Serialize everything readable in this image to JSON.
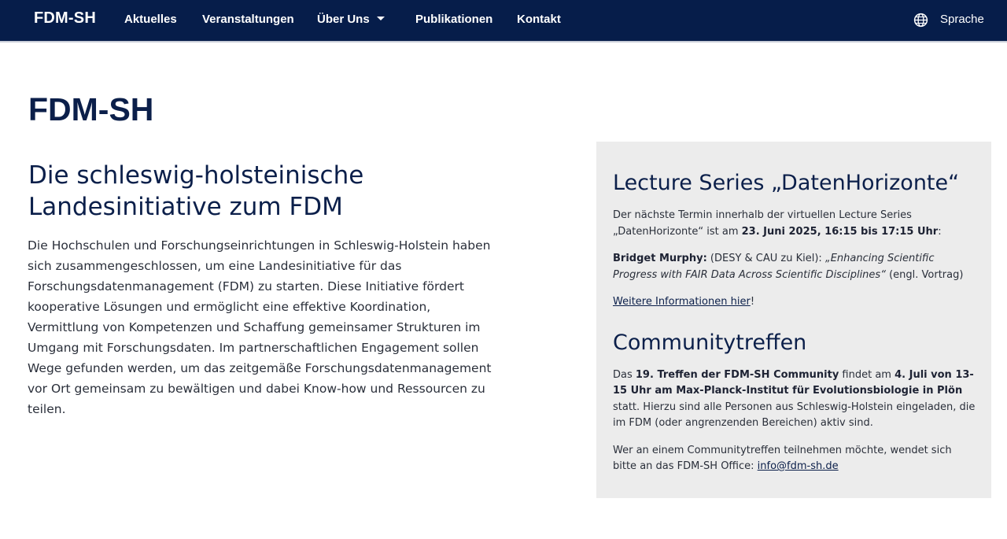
{
  "nav": {
    "brand": "FDM-SH",
    "items": [
      {
        "label": "Aktuelles"
      },
      {
        "label": "Veranstaltungen"
      },
      {
        "label": "Über Uns"
      },
      {
        "label": "Publikationen"
      },
      {
        "label": "Kontakt"
      }
    ],
    "language_label": "Sprache",
    "language_icon": "globe-icon",
    "about_dropdown_icon": "caret-down-icon"
  },
  "main": {
    "title": "FDM-SH",
    "subtitle": "Die schleswig-holsteinische Landesinitiative zum FDM",
    "intro": "Die Hochschulen und Forschungseinrichtungen in Schleswig-Holstein haben sich zusammengeschlossen, um eine Landesinitiative für das Forschungsdatenmanagement (FDM) zu starten. Diese Initiative fördert kooperative Lösungen und ermöglicht eine effektive Koordination, Vermittlung von Kompetenzen und Schaffung gemeinsamer Strukturen im Umgang mit Forschungsdaten. Im partnerschaftlichen Engagement sollen Wege gefunden werden, um das zeitgemäße Forschungsdatenmanagement vor Ort gemeinsam zu bewältigen und dabei Know-how und Ressourcen zu teilen."
  },
  "sidebar": {
    "lecture": {
      "heading": "Lecture Series „DatenHorizonte“",
      "p1_text": "Der nächste Termin innerhalb der virtuellen Lecture Series „DatenHorizonte“ ist am ",
      "p1_date": "23. Juni 2025, 16:15 bis 17:15 Uhr",
      "p1_end": ":",
      "speaker": "Bridget Murphy:",
      "affiliation": " (DESY & CAU zu Kiel): ",
      "talk_title": "„Enhancing Scientific Progress with FAIR Data Across Scientific Disciplines“",
      "talk_note": " (engl. Vortrag)",
      "more_link": "Weitere Informationen hier",
      "more_end": "!"
    },
    "community": {
      "heading": "Communitytreffen",
      "p1_a": "Das ",
      "p1_b1": "19. Treffen der FDM-SH Community",
      "p1_c": " findet am ",
      "p1_b2": "4. Juli von 13-15 Uhr am Max-Planck-Institut für Evolutionsbiologie in Plön",
      "p1_d": " statt. Hierzu sind alle Personen aus Schleswig-Holstein eingeladen, die im FDM (oder angrenzenden Bereichen) aktiv sind.",
      "p2_text": "Wer an einem Communitytreffen teilnehmen möchte, wendet sich bitte an das FDM-SH Office: ",
      "email": "info@fdm-sh.de"
    }
  },
  "colors": {
    "navbar_bg": "#061d4a",
    "heading": "#0b1f4a",
    "sidebar_bg": "#ececec"
  }
}
